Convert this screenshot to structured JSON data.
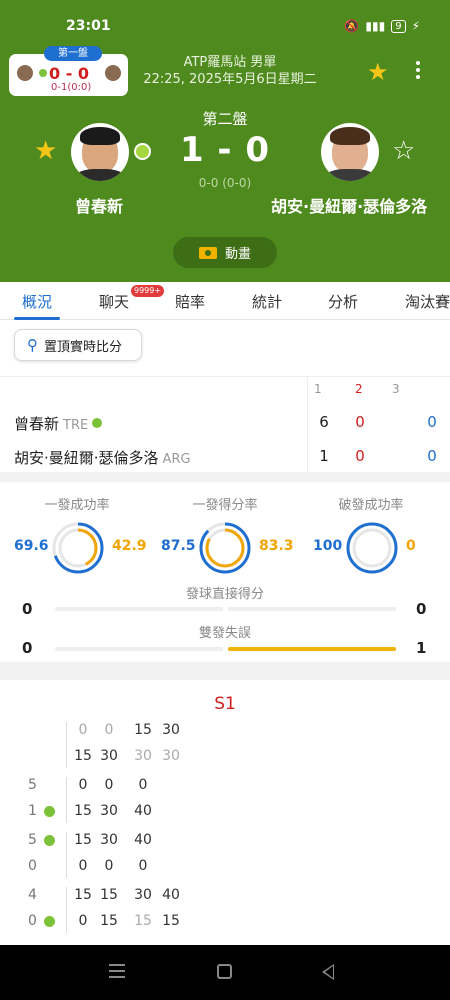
{
  "status_bar": {
    "time": "23:01",
    "battery": "9",
    "icons": [
      "mute-icon",
      "signal-icon",
      "battery-icon",
      "charging-icon"
    ]
  },
  "header": {
    "tournament": "ATP羅馬站 男單",
    "datetime": "22:25, 2025年5月6日星期二",
    "set_label": "第二盤",
    "score": "1 - 0",
    "score_sub": "0-0 (0-0)",
    "animation_label": "動畫",
    "mini_card": {
      "tag": "第一盤",
      "score": "0 - 0",
      "sub": "0-1(0:0)"
    },
    "player1": {
      "name": "曾春新",
      "starred": true
    },
    "player2": {
      "name": "胡安·曼紐爾·瑟倫多洛",
      "starred": false
    }
  },
  "tabs": [
    {
      "label": "概況",
      "active": true
    },
    {
      "label": "聊天",
      "badge": "9999+"
    },
    {
      "label": "賠率"
    },
    {
      "label": "統計"
    },
    {
      "label": "分析"
    },
    {
      "label": "淘汰賽"
    }
  ],
  "pin_button": "置頂實時比分",
  "score_table": {
    "set_headers": [
      "1",
      "2",
      "3"
    ],
    "rows": [
      {
        "name": "曾春新",
        "country": "TRE",
        "serving": true,
        "sets": [
          "6",
          "0",
          "0"
        ]
      },
      {
        "name": "胡安·曼紐爾·瑟倫多洛",
        "country": "ARG",
        "serving": false,
        "sets": [
          "1",
          "0",
          "0"
        ]
      }
    ]
  },
  "stats": {
    "rings": [
      {
        "title": "一發成功率",
        "left": "69.6",
        "right": "42.9",
        "left_pct": 69.6,
        "right_pct": 42.9
      },
      {
        "title": "一發得分率",
        "left": "87.5",
        "right": "83.3",
        "left_pct": 87.5,
        "right_pct": 83.3
      },
      {
        "title": "破發成功率",
        "left": "100",
        "right": "0",
        "left_pct": 100,
        "right_pct": 0
      }
    ],
    "bars": [
      {
        "title": "發球直接得分",
        "left": "0",
        "right": "0",
        "left_pct": 0,
        "right_pct": 0
      },
      {
        "title": "雙發失誤",
        "left": "0",
        "right": "1",
        "left_pct": 0,
        "right_pct": 100
      }
    ]
  },
  "point_by_point": {
    "title": "S1",
    "games": [
      {
        "label_top": "",
        "label_bottom": "",
        "top": [
          "0",
          "0",
          "15",
          "30"
        ],
        "bottom": [
          "15",
          "30",
          "30",
          "30"
        ],
        "serve": ""
      },
      {
        "label_top": "5",
        "label_bottom": "1",
        "top": [
          "0",
          "0",
          "0"
        ],
        "bottom": [
          "15",
          "30",
          "40"
        ],
        "serve": "bottom"
      },
      {
        "label_top": "5",
        "label_bottom": "0",
        "top": [
          "15",
          "30",
          "40"
        ],
        "bottom": [
          "0",
          "0",
          "0"
        ],
        "serve": "top"
      },
      {
        "label_top": "4",
        "label_bottom": "0",
        "top": [
          "15",
          "15",
          "30",
          "40"
        ],
        "bottom": [
          "0",
          "15",
          "15",
          "15"
        ],
        "serve": "bottom"
      }
    ]
  }
}
